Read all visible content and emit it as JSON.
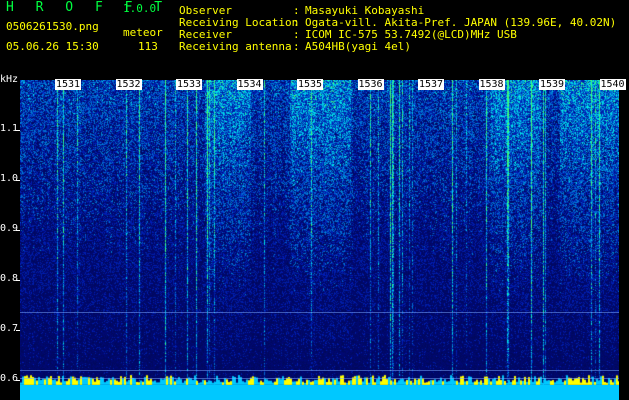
{
  "header": {
    "app_name": "H R O F F T",
    "version": "1.0.0",
    "filename": "0506261530.png",
    "mode": "meteor",
    "datetime": "05.06.26 15:30",
    "count": "113"
  },
  "info": [
    {
      "key": "Observer",
      "value": "Masayuki Kobayashi"
    },
    {
      "key": "Receiving Location",
      "value": "Ogata-vill. Akita-Pref. JAPAN (139.96E, 40.02N)"
    },
    {
      "key": "Receiver",
      "value": "ICOM IC-575 53.7492(@LCD)MHz USB"
    },
    {
      "key": "Receiving antenna",
      "value": "A504HB(yagi 4el)"
    }
  ],
  "info_separator": ":",
  "axis": {
    "unit": "kHz",
    "y_ticks": [
      "1.1",
      "1.0",
      "0.9",
      "0.8",
      "0.7",
      "0.6"
    ]
  },
  "time_labels": [
    "1531",
    "1532",
    "1533",
    "1534",
    "1535",
    "1536",
    "1537",
    "1538",
    "1539",
    "1540"
  ],
  "colors": {
    "header_green": "#00ff40",
    "header_yellow": "#ffff00",
    "plot_bg": "#00107a",
    "baseline": "#00c8ff"
  }
}
